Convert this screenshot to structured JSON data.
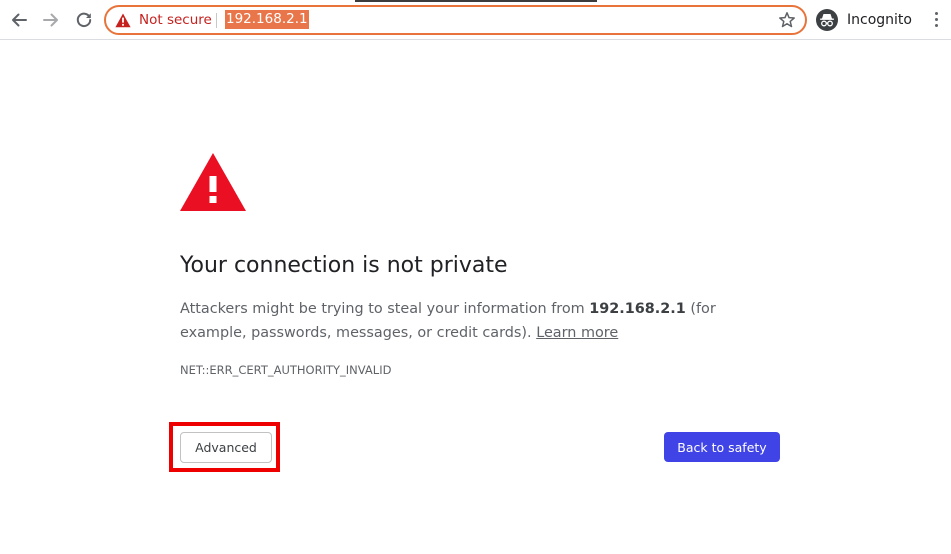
{
  "browser": {
    "security_label": "Not secure",
    "url": "192.168.2.1",
    "profile_label": "Incognito",
    "omnibox_border_color": "#e8743b",
    "url_highlight_color": "#e9764a",
    "security_color": "#c5221f"
  },
  "interstitial": {
    "heading": "Your connection is not private",
    "message_prefix": "Attackers might be trying to steal your information from ",
    "host": "192.168.2.1",
    "message_suffix": " (for example, passwords, messages, or credit cards). ",
    "learn_more": "Learn more",
    "error_code": "NET::ERR_CERT_AUTHORITY_INVALID",
    "advanced_label": "Advanced",
    "back_to_safety_label": "Back to safety",
    "warning_color": "#ea0f22",
    "primary_button_color": "#4043e5",
    "highlight_color": "#ee0000"
  }
}
